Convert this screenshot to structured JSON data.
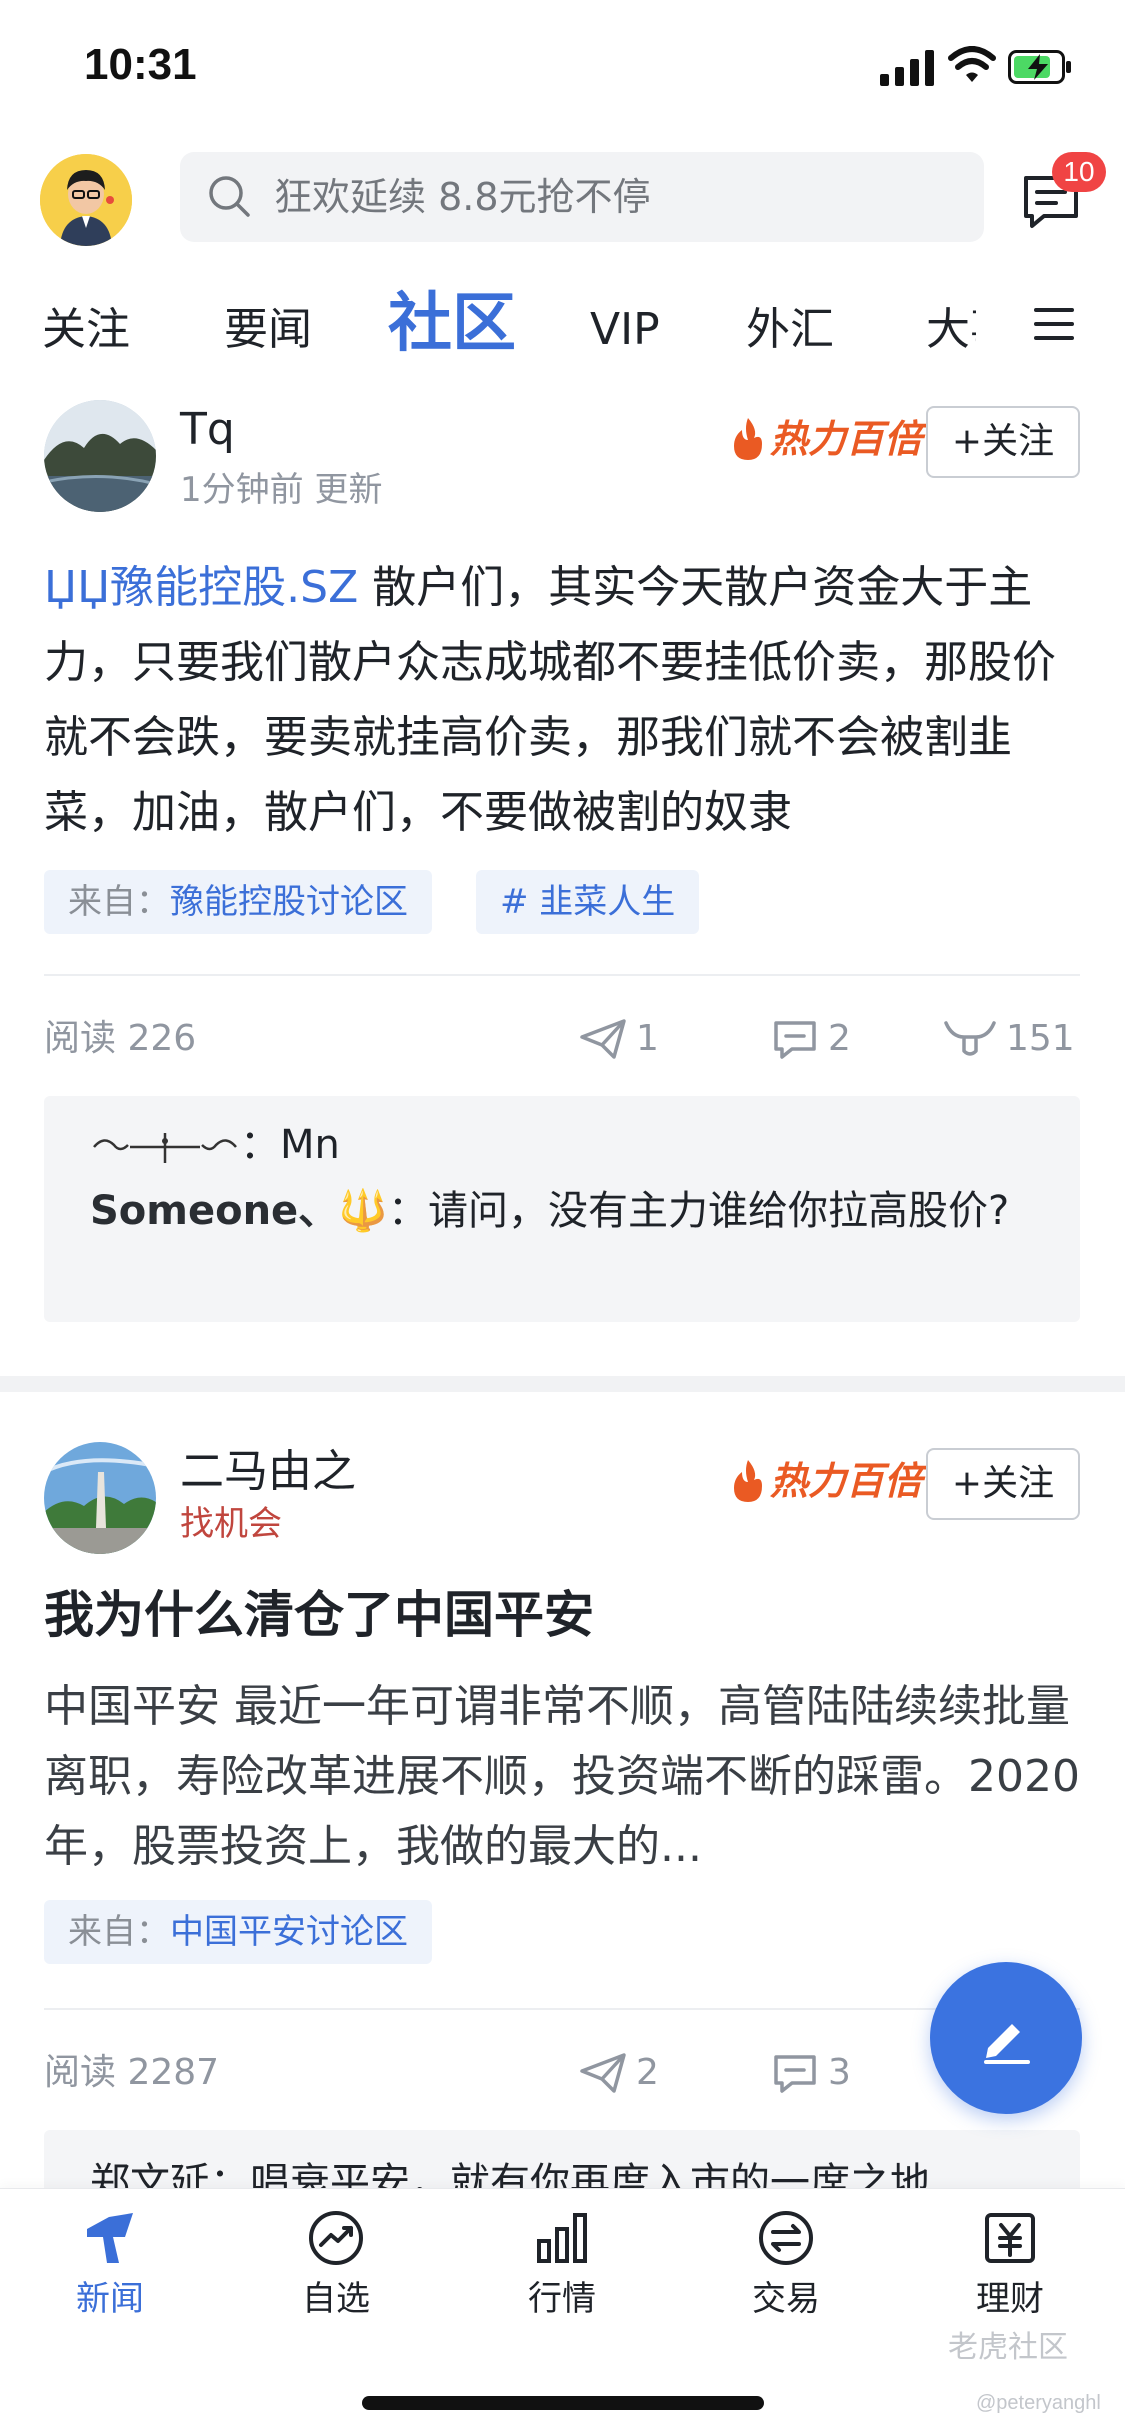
{
  "status": {
    "time": "10:31"
  },
  "header": {
    "search_placeholder": "狂欢延续 8.8元抢不停",
    "message_badge": "10"
  },
  "tabs": [
    {
      "label": "关注"
    },
    {
      "label": "要闻"
    },
    {
      "label": "社区",
      "active": true
    },
    {
      "label": "VIP"
    },
    {
      "label": "外汇"
    },
    {
      "label": "大事"
    }
  ],
  "posts": [
    {
      "author": "Tq",
      "meta": "1分钟前 更新",
      "hot_label": "热力百倍",
      "follow_label": "+关注",
      "stock_link": "ЏЏ豫能控股.SZ",
      "body": " 散户们，其实今天散户资金大于主力，只要我们散户众志成城都不要挂低价卖，那股价就不会跌，要卖就挂高价卖，那我们就不会被割韭菜，加油，散户们，不要做被割的奴隶",
      "tags": [
        {
          "prefix": "来自：",
          "link": "豫能控股讨论区"
        },
        {
          "prefix": "",
          "link": "# 韭菜人生"
        }
      ],
      "reads": "阅读 226",
      "shares": "1",
      "comments": "2",
      "likes": "151",
      "comment_preview": {
        "line1_name": "",
        "line1_text": "：Mn",
        "line2_name": "Someone、🔱",
        "line2_text": "：请问，没有主力谁给你拉高股价?"
      }
    },
    {
      "author": "二马由之",
      "meta": "找机会",
      "hot_label": "热力百倍",
      "follow_label": "+关注",
      "title": "我为什么清仓了中国平安",
      "body": " 中国平安 最近一年可谓非常不顺，高管陆陆续续批量离职，寿险改革进展不顺，投资端不断的踩雷。2020年，股票投资上，我做的最大的...",
      "tags": [
        {
          "prefix": "来自：",
          "link": "中国平安讨论区"
        }
      ],
      "reads": "阅读 2287",
      "shares": "2",
      "comments": "3",
      "comment_preview_partial": "郑文延：唱衰平安，就有你再度入市的一席之地"
    }
  ],
  "bottom_nav": [
    {
      "label": "新闻",
      "icon": "news-icon",
      "active": true
    },
    {
      "label": "自选",
      "icon": "watchlist-icon"
    },
    {
      "label": "行情",
      "icon": "market-icon"
    },
    {
      "label": "交易",
      "icon": "trade-icon"
    },
    {
      "label": "理财",
      "icon": "wealth-icon"
    }
  ],
  "watermark": "老虎社区",
  "watermark_handle": "@peteryanghl",
  "colors": {
    "accent": "#3b6fd8",
    "hot": "#ea5a23",
    "badge": "#f04444",
    "fab": "#3b73e0"
  }
}
